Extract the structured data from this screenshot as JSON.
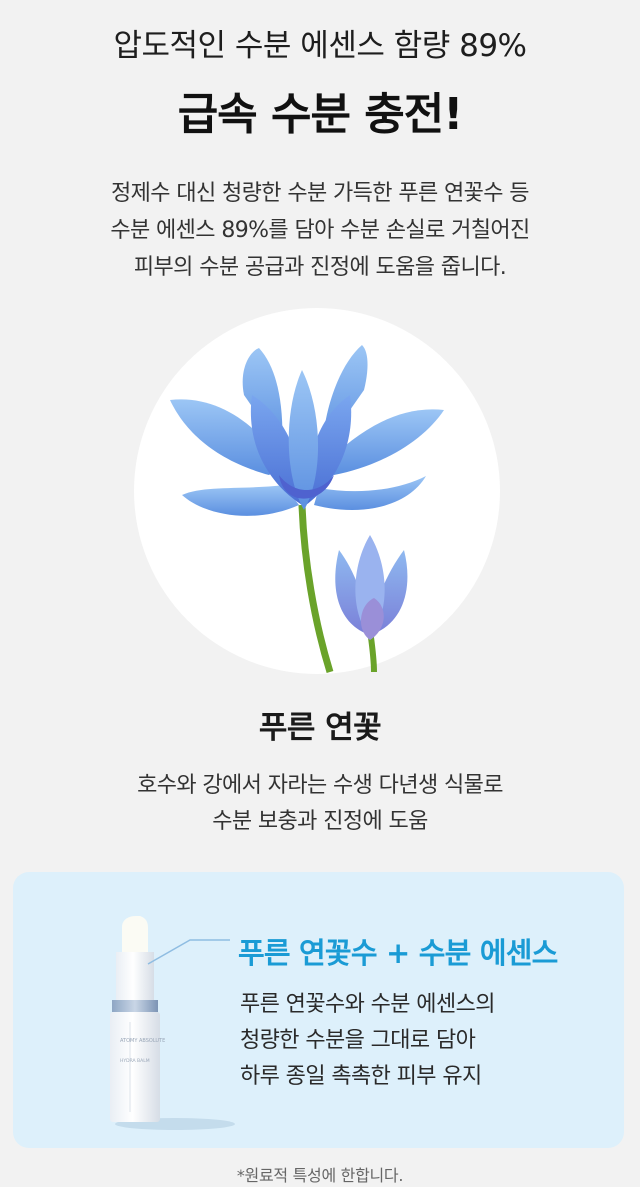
{
  "header": {
    "sub_heading": "압도적인 수분 에센스 함량 89%",
    "main_heading": "급속 수분 충전!"
  },
  "intro": {
    "lines": [
      "정제수 대신 청량한 수분 가득한 푸른 연꽃수 등",
      "수분 에센스 89%를 담아 수분 손실로 거칠어진",
      "피부의 수분 공급과 진정에 도움을 줍니다."
    ]
  },
  "lotus": {
    "title": "푸른 연꽃",
    "desc_lines": [
      "호수와 강에서 자라는 수생 다년생 식물로",
      "수분 보충과 진정에 도움"
    ]
  },
  "product_panel": {
    "title": "푸른 연꽃수 + 수분 에센스",
    "desc_lines": [
      "푸른 연꽃수와 수분 에센스의",
      "청량한 수분을 그대로 담아",
      "하루 종일 촉촉한 피부 유지"
    ],
    "product_label_brand": "ATOMY ABSOLUTE",
    "product_label_name": "HYDRA BALM"
  },
  "footnote": "*원료적 특성에 한합니다.",
  "colors": {
    "background": "#f2f2f2",
    "panel_bg": "#ddf0fb",
    "accent_blue": "#1a9bd5",
    "lotus_blue": "#6fa8e8"
  }
}
